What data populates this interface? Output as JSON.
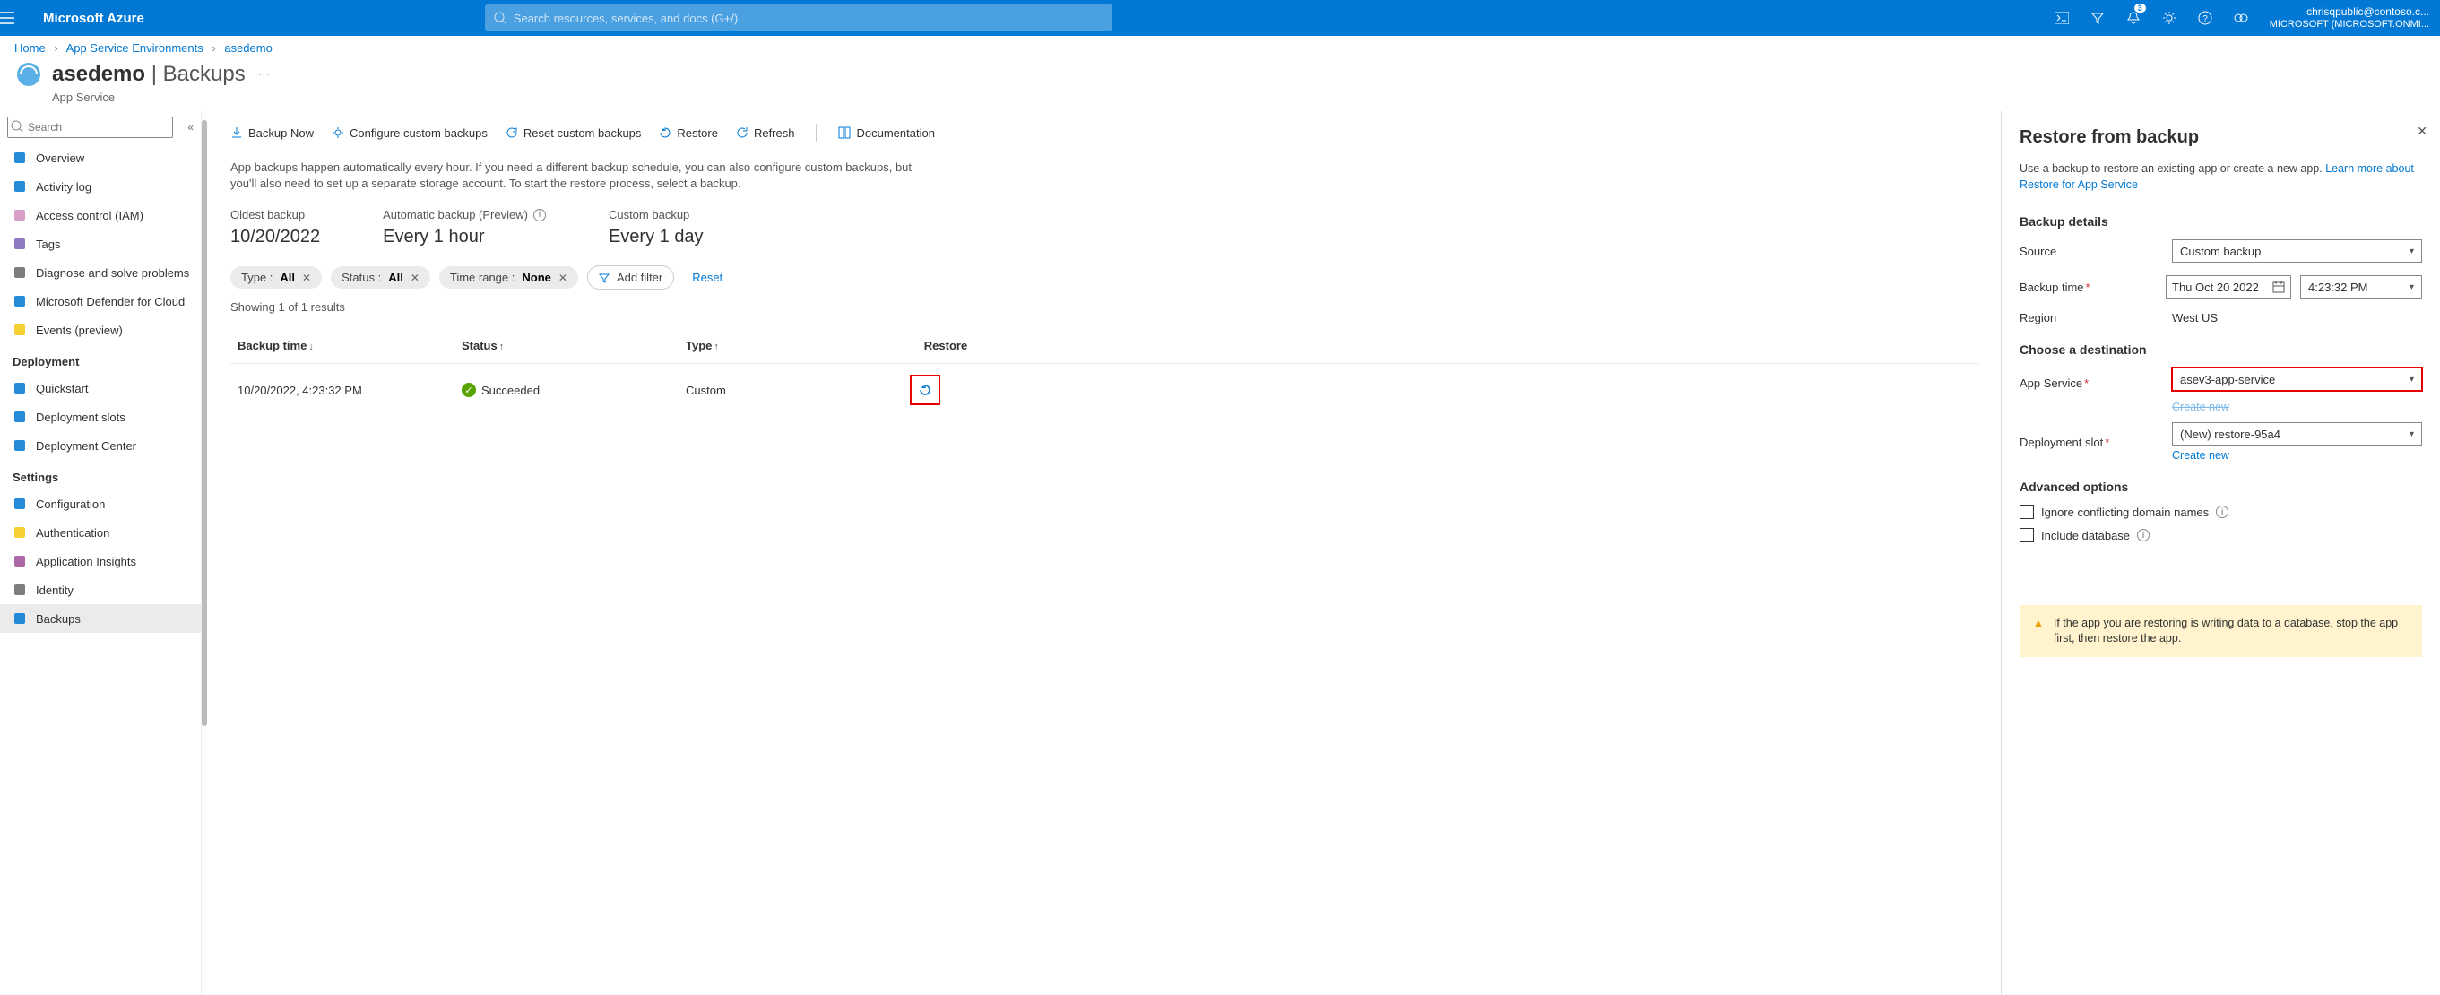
{
  "topbar": {
    "brand": "Microsoft Azure",
    "search_placeholder": "Search resources, services, and docs (G+/)",
    "notification_count": "3",
    "account_email": "chrisqpublic@contoso.c...",
    "account_tenant": "MICROSOFT (MICROSOFT.ONMI..."
  },
  "breadcrumbs": {
    "home": "Home",
    "level1": "App Service Environments",
    "level2": "asedemo"
  },
  "page": {
    "title_main": "asedemo",
    "title_sub": "Backups",
    "subtype": "App Service",
    "search_placeholder": "Search"
  },
  "sidebar": {
    "groups": [
      {
        "label": "",
        "items": [
          {
            "label": "Overview",
            "icon": "globe",
            "color": "#0078d4"
          },
          {
            "label": "Activity log",
            "icon": "log",
            "color": "#0078d4"
          },
          {
            "label": "Access control (IAM)",
            "icon": "people",
            "color": "#d18fbd"
          },
          {
            "label": "Tags",
            "icon": "tag",
            "color": "#7b61b5"
          },
          {
            "label": "Diagnose and solve problems",
            "icon": "wrench",
            "color": "#666"
          },
          {
            "label": "Microsoft Defender for Cloud",
            "icon": "shield",
            "color": "#0078d4"
          },
          {
            "label": "Events (preview)",
            "icon": "bolt",
            "color": "#f2c811"
          }
        ]
      },
      {
        "label": "Deployment",
        "items": [
          {
            "label": "Quickstart",
            "icon": "rocket",
            "color": "#0078d4"
          },
          {
            "label": "Deployment slots",
            "icon": "slots",
            "color": "#0078d4"
          },
          {
            "label": "Deployment Center",
            "icon": "cloud",
            "color": "#0078d4"
          }
        ]
      },
      {
        "label": "Settings",
        "items": [
          {
            "label": "Configuration",
            "icon": "sliders",
            "color": "#0078d4"
          },
          {
            "label": "Authentication",
            "icon": "key",
            "color": "#f2c811"
          },
          {
            "label": "Application Insights",
            "icon": "bulb",
            "color": "#9b4f96"
          },
          {
            "label": "Identity",
            "icon": "id",
            "color": "#666"
          },
          {
            "label": "Backups",
            "icon": "backup",
            "color": "#0078d4",
            "active": true
          }
        ]
      }
    ]
  },
  "toolbar": {
    "backup_now": "Backup Now",
    "configure": "Configure custom backups",
    "reset": "Reset custom backups",
    "restore": "Restore",
    "refresh": "Refresh",
    "docs": "Documentation"
  },
  "info_text": "App backups happen automatically every hour. If you need a different backup schedule, you can also configure custom backups, but you'll also need to set up a separate storage account. To start the restore process, select a backup.",
  "metrics": {
    "oldest_label": "Oldest backup",
    "oldest_value": "10/20/2022",
    "auto_label": "Automatic backup (Preview)",
    "auto_value": "Every 1 hour",
    "custom_label": "Custom backup",
    "custom_value": "Every 1 day"
  },
  "filters": {
    "type_label": "Type :",
    "type_value": "All",
    "status_label": "Status :",
    "status_value": "All",
    "time_label": "Time range :",
    "time_value": "None",
    "add_filter": "Add filter",
    "reset": "Reset"
  },
  "results_text": "Showing 1 of 1 results",
  "grid": {
    "headers": {
      "time": "Backup time",
      "status": "Status",
      "type": "Type",
      "restore": "Restore"
    },
    "rows": [
      {
        "time": "10/20/2022, 4:23:32 PM",
        "status": "Succeeded",
        "type": "Custom"
      }
    ]
  },
  "panel": {
    "title": "Restore from backup",
    "intro_text": "Use a backup to restore an existing app or create a new app. ",
    "intro_link": "Learn more about Restore for App Service",
    "section_backup": "Backup details",
    "source_label": "Source",
    "source_value": "Custom backup",
    "time_label": "Backup time",
    "time_date": "Thu Oct 20 2022",
    "time_value": "4:23:32 PM",
    "region_label": "Region",
    "region_value": "West US",
    "section_dest": "Choose a destination",
    "appservice_label": "App Service",
    "appservice_value": "asev3-app-service",
    "create_new": "Create new",
    "slot_label": "Deployment slot",
    "slot_value": "(New) restore-95a4",
    "section_adv": "Advanced options",
    "opt_ignore": "Ignore conflicting domain names",
    "opt_include": "Include database",
    "warning": "If the app you are restoring is writing data to a database, stop the app first, then restore the app."
  }
}
